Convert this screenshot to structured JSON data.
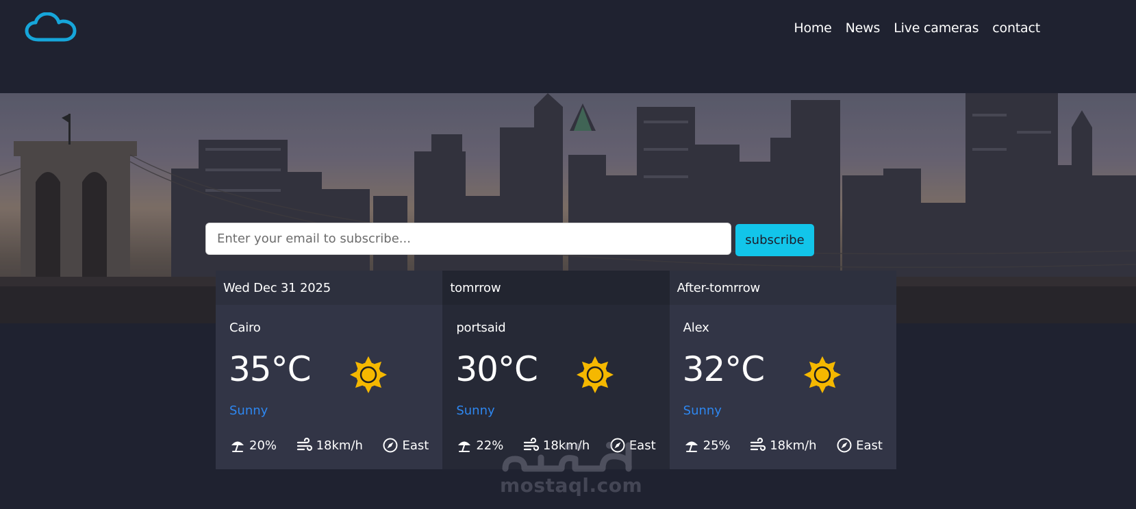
{
  "nav": {
    "logo_icon": "cloud-icon",
    "links": [
      "Home",
      "News",
      "Live cameras",
      "contact"
    ]
  },
  "subscribe": {
    "placeholder": "Enter your email to subscribe...",
    "button_label": "subscribe"
  },
  "forecast": [
    {
      "header": "Wed Dec 31 2025",
      "city": "Cairo",
      "temp": "35°C",
      "condition": "Sunny",
      "icon": "sun-icon",
      "rain": "20%",
      "wind": "18km/h",
      "direction": "East"
    },
    {
      "header": "tomrrow",
      "city": "portsaid",
      "temp": "30°C",
      "condition": "Sunny",
      "icon": "sun-icon",
      "rain": "22%",
      "wind": "18km/h",
      "direction": "East"
    },
    {
      "header": "After-tomrrow",
      "city": "Alex",
      "temp": "32°C",
      "condition": "Sunny",
      "icon": "sun-icon",
      "rain": "25%",
      "wind": "18km/h",
      "direction": "East"
    }
  ],
  "watermark": {
    "text": "mostaql.com"
  },
  "colors": {
    "background": "#1f2230",
    "accent": "#12c5ea",
    "condition": "#2e87f0",
    "sun": "#f5b800"
  }
}
